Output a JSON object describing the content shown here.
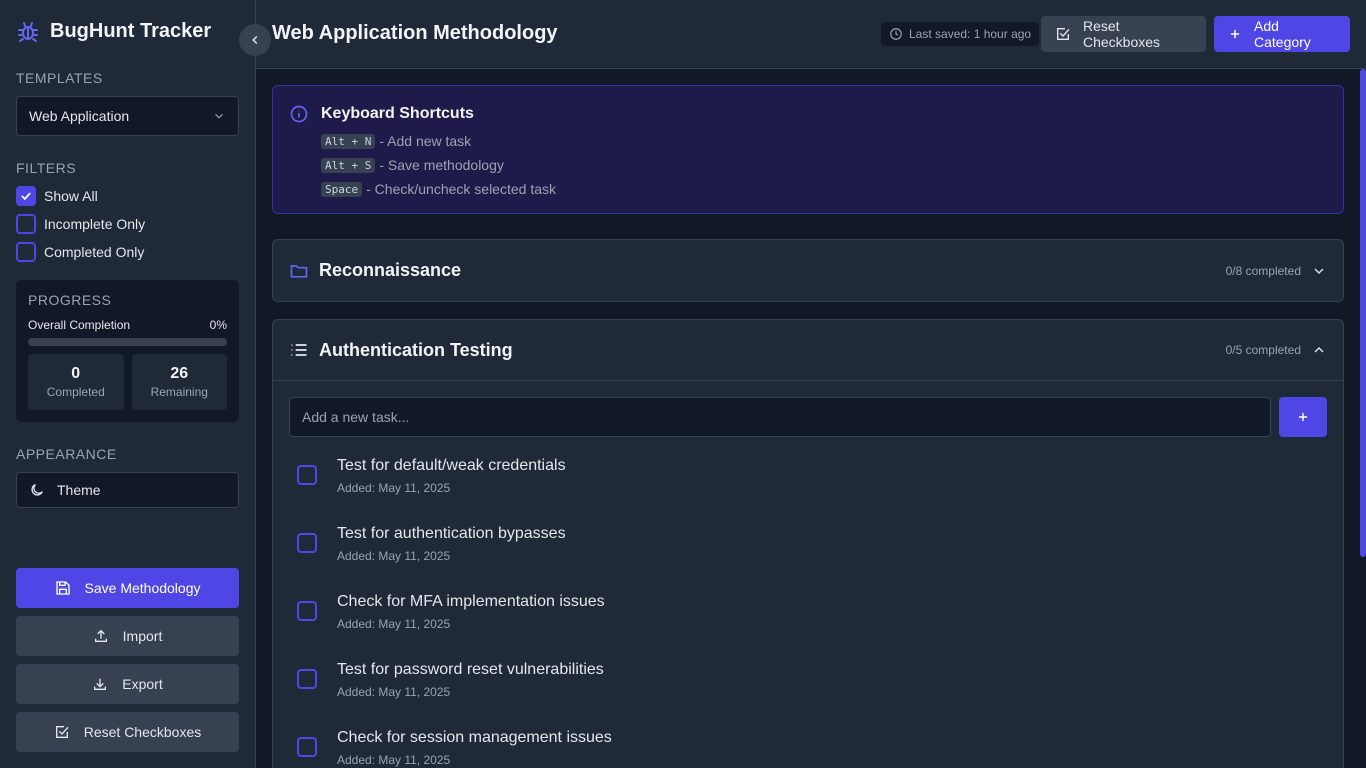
{
  "app": {
    "title": "BugHunt Tracker"
  },
  "sidebar": {
    "templates_label": "TEMPLATES",
    "template_selected": "Web Application",
    "filters_label": "FILTERS",
    "filters": [
      {
        "label": "Show All",
        "checked": true
      },
      {
        "label": "Incomplete Only",
        "checked": false
      },
      {
        "label": "Completed Only",
        "checked": false
      }
    ],
    "progress": {
      "label": "PROGRESS",
      "overall_label": "Overall Completion",
      "overall_value": "0%",
      "overall_fraction": 0,
      "completed_count": "0",
      "completed_label": "Completed",
      "remaining_count": "26",
      "remaining_label": "Remaining"
    },
    "appearance_label": "APPEARANCE",
    "theme_label": "Theme",
    "actions": {
      "save": "Save Methodology",
      "import": "Import",
      "export": "Export",
      "reset": "Reset Checkboxes"
    }
  },
  "header": {
    "title": "Web Application Methodology",
    "last_saved": "Last saved: 1 hour ago",
    "reset_label": "Reset Checkboxes",
    "add_category_label": "Add Category"
  },
  "shortcuts": {
    "title": "Keyboard Shortcuts",
    "items": [
      {
        "key": "Alt + N",
        "desc": "- Add new task"
      },
      {
        "key": "Alt + S",
        "desc": "- Save methodology"
      },
      {
        "key": "Space",
        "desc": "- Check/uncheck selected task"
      }
    ]
  },
  "categories": [
    {
      "title": "Reconnaissance",
      "count": "0/8 completed",
      "expanded": false,
      "icon": "folder-icon"
    },
    {
      "title": "Authentication Testing",
      "count": "0/5 completed",
      "expanded": true,
      "icon": "list-icon",
      "task_placeholder": "Add a new task...",
      "tasks": [
        {
          "text": "Test for default/weak credentials",
          "date": "Added: May 11, 2025"
        },
        {
          "text": "Test for authentication bypasses",
          "date": "Added: May 11, 2025"
        },
        {
          "text": "Check for MFA implementation issues",
          "date": "Added: May 11, 2025"
        },
        {
          "text": "Test for password reset vulnerabilities",
          "date": "Added: May 11, 2025"
        },
        {
          "text": "Check for session management issues",
          "date": "Added: May 11, 2025"
        }
      ]
    }
  ],
  "colors": {
    "accent": "#4f46e5",
    "background": "#111827",
    "panel": "#1f2937"
  }
}
